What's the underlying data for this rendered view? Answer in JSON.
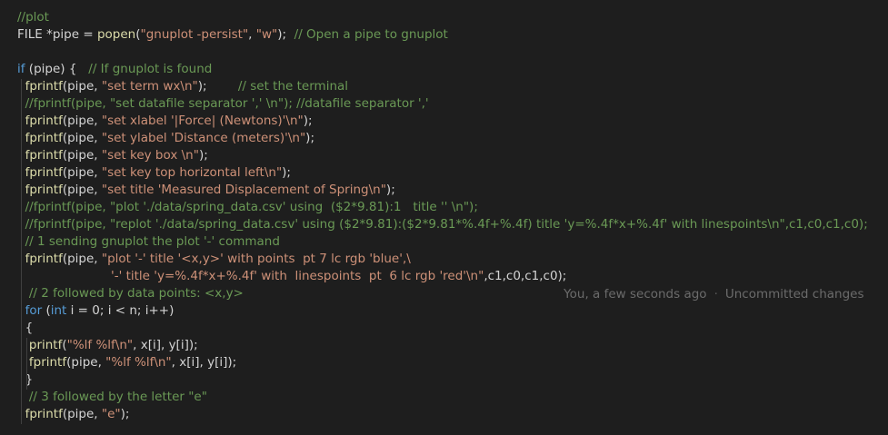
{
  "colors": {
    "background": "#1e1e1e",
    "comment": "#6a9955",
    "keyword": "#569cd6",
    "string": "#ce9178",
    "function": "#dcdcaa",
    "identifier": "#d4d4d4",
    "blame": "#6b6b6b"
  },
  "lines": [
    {
      "tokens": [
        {
          "t": "comment",
          "v": "//plot"
        }
      ]
    },
    {
      "tokens": [
        {
          "t": "ident",
          "v": "FILE *pipe = "
        },
        {
          "t": "func",
          "v": "popen"
        },
        {
          "t": "ident",
          "v": "("
        },
        {
          "t": "string",
          "v": "\"gnuplot -persist\""
        },
        {
          "t": "ident",
          "v": ", "
        },
        {
          "t": "string",
          "v": "\"w\""
        },
        {
          "t": "ident",
          "v": ");  "
        },
        {
          "t": "comment",
          "v": "// Open a pipe to gnuplot"
        }
      ]
    },
    {
      "tokens": []
    },
    {
      "tokens": [
        {
          "t": "keyword",
          "v": "if"
        },
        {
          "t": "ident",
          "v": " (pipe) {   "
        },
        {
          "t": "comment",
          "v": "// If gnuplot is found"
        }
      ]
    },
    {
      "tokens": [
        {
          "t": "ident",
          "v": "  "
        },
        {
          "t": "func",
          "v": "fprintf"
        },
        {
          "t": "ident",
          "v": "(pipe, "
        },
        {
          "t": "string",
          "v": "\"set term wx\\n\""
        },
        {
          "t": "ident",
          "v": ");        "
        },
        {
          "t": "comment",
          "v": "// set the terminal"
        }
      ]
    },
    {
      "tokens": [
        {
          "t": "ident",
          "v": "  "
        },
        {
          "t": "comment",
          "v": "//fprintf(pipe, \"set datafile separator ',' \\n\"); //datafile separator ','"
        }
      ]
    },
    {
      "tokens": [
        {
          "t": "ident",
          "v": "  "
        },
        {
          "t": "func",
          "v": "fprintf"
        },
        {
          "t": "ident",
          "v": "(pipe, "
        },
        {
          "t": "string",
          "v": "\"set xlabel '|Force| (Newtons)'\\n\""
        },
        {
          "t": "ident",
          "v": ");"
        }
      ]
    },
    {
      "tokens": [
        {
          "t": "ident",
          "v": "  "
        },
        {
          "t": "func",
          "v": "fprintf"
        },
        {
          "t": "ident",
          "v": "(pipe, "
        },
        {
          "t": "string",
          "v": "\"set ylabel 'Distance (meters)'\\n\""
        },
        {
          "t": "ident",
          "v": ");"
        }
      ]
    },
    {
      "tokens": [
        {
          "t": "ident",
          "v": "  "
        },
        {
          "t": "func",
          "v": "fprintf"
        },
        {
          "t": "ident",
          "v": "(pipe, "
        },
        {
          "t": "string",
          "v": "\"set key box \\n\""
        },
        {
          "t": "ident",
          "v": ");"
        }
      ]
    },
    {
      "tokens": [
        {
          "t": "ident",
          "v": "  "
        },
        {
          "t": "func",
          "v": "fprintf"
        },
        {
          "t": "ident",
          "v": "(pipe, "
        },
        {
          "t": "string",
          "v": "\"set key top horizontal left\\n\""
        },
        {
          "t": "ident",
          "v": ");"
        }
      ]
    },
    {
      "tokens": [
        {
          "t": "ident",
          "v": "  "
        },
        {
          "t": "func",
          "v": "fprintf"
        },
        {
          "t": "ident",
          "v": "(pipe, "
        },
        {
          "t": "string",
          "v": "\"set title 'Measured Displacement of Spring\\n\""
        },
        {
          "t": "ident",
          "v": ");"
        }
      ]
    },
    {
      "tokens": [
        {
          "t": "ident",
          "v": "  "
        },
        {
          "t": "comment",
          "v": "//fprintf(pipe, \"plot './data/spring_data.csv' using  ($2*9.81):1   title '' \\n\");"
        }
      ]
    },
    {
      "tokens": [
        {
          "t": "ident",
          "v": "  "
        },
        {
          "t": "comment",
          "v": "//fprintf(pipe, \"replot './data/spring_data.csv' using ($2*9.81):($2*9.81*%.4f+%.4f) title 'y=%.4f*x+%.4f' with linespoints\\n\",c1,c0,c1,c0);"
        }
      ]
    },
    {
      "tokens": [
        {
          "t": "ident",
          "v": "  "
        },
        {
          "t": "comment",
          "v": "// 1 sending gnuplot the plot '-' command"
        }
      ]
    },
    {
      "tokens": [
        {
          "t": "ident",
          "v": "  "
        },
        {
          "t": "func",
          "v": "fprintf"
        },
        {
          "t": "ident",
          "v": "(pipe, "
        },
        {
          "t": "string",
          "v": "\"plot '-' title '<x,y>' with points  pt 7 lc rgb 'blue',\\"
        }
      ]
    },
    {
      "tokens": [
        {
          "t": "ident",
          "v": "                        "
        },
        {
          "t": "string",
          "v": "'-' title 'y=%.4f*x+%.4f' with  linespoints  pt  6 lc rgb 'red'\\n\""
        },
        {
          "t": "ident",
          "v": ",c1,c0,c1,c0);"
        }
      ]
    },
    {
      "tokens": [
        {
          "t": "ident",
          "v": "   "
        },
        {
          "t": "comment",
          "v": "// 2 followed by data points: <x,y>"
        }
      ]
    },
    {
      "tokens": [
        {
          "t": "ident",
          "v": "  "
        },
        {
          "t": "keyword",
          "v": "for"
        },
        {
          "t": "ident",
          "v": " ("
        },
        {
          "t": "keyword",
          "v": "int"
        },
        {
          "t": "ident",
          "v": " i = 0; i < n; i++)"
        }
      ]
    },
    {
      "tokens": [
        {
          "t": "ident",
          "v": "  {"
        }
      ]
    },
    {
      "tokens": [
        {
          "t": "ident",
          "v": "   "
        },
        {
          "t": "func",
          "v": "printf"
        },
        {
          "t": "ident",
          "v": "("
        },
        {
          "t": "string",
          "v": "\"%lf %lf\\n\""
        },
        {
          "t": "ident",
          "v": ", x[i], y[i]);"
        }
      ]
    },
    {
      "tokens": [
        {
          "t": "ident",
          "v": "   "
        },
        {
          "t": "func",
          "v": "fprintf"
        },
        {
          "t": "ident",
          "v": "(pipe, "
        },
        {
          "t": "string",
          "v": "\"%lf %lf\\n\""
        },
        {
          "t": "ident",
          "v": ", x[i], y[i]);"
        }
      ]
    },
    {
      "tokens": [
        {
          "t": "ident",
          "v": "  }"
        }
      ]
    },
    {
      "tokens": [
        {
          "t": "ident",
          "v": "   "
        },
        {
          "t": "comment",
          "v": "// 3 followed by the letter \"e\""
        }
      ]
    },
    {
      "tokens": [
        {
          "t": "ident",
          "v": "  "
        },
        {
          "t": "func",
          "v": "fprintf"
        },
        {
          "t": "ident",
          "v": "(pipe, "
        },
        {
          "t": "string",
          "v": "\"e\""
        },
        {
          "t": "ident",
          "v": ");"
        }
      ]
    }
  ],
  "blame": {
    "author": "You, a few seconds ago",
    "separator": "·",
    "status": "Uncommitted changes"
  }
}
